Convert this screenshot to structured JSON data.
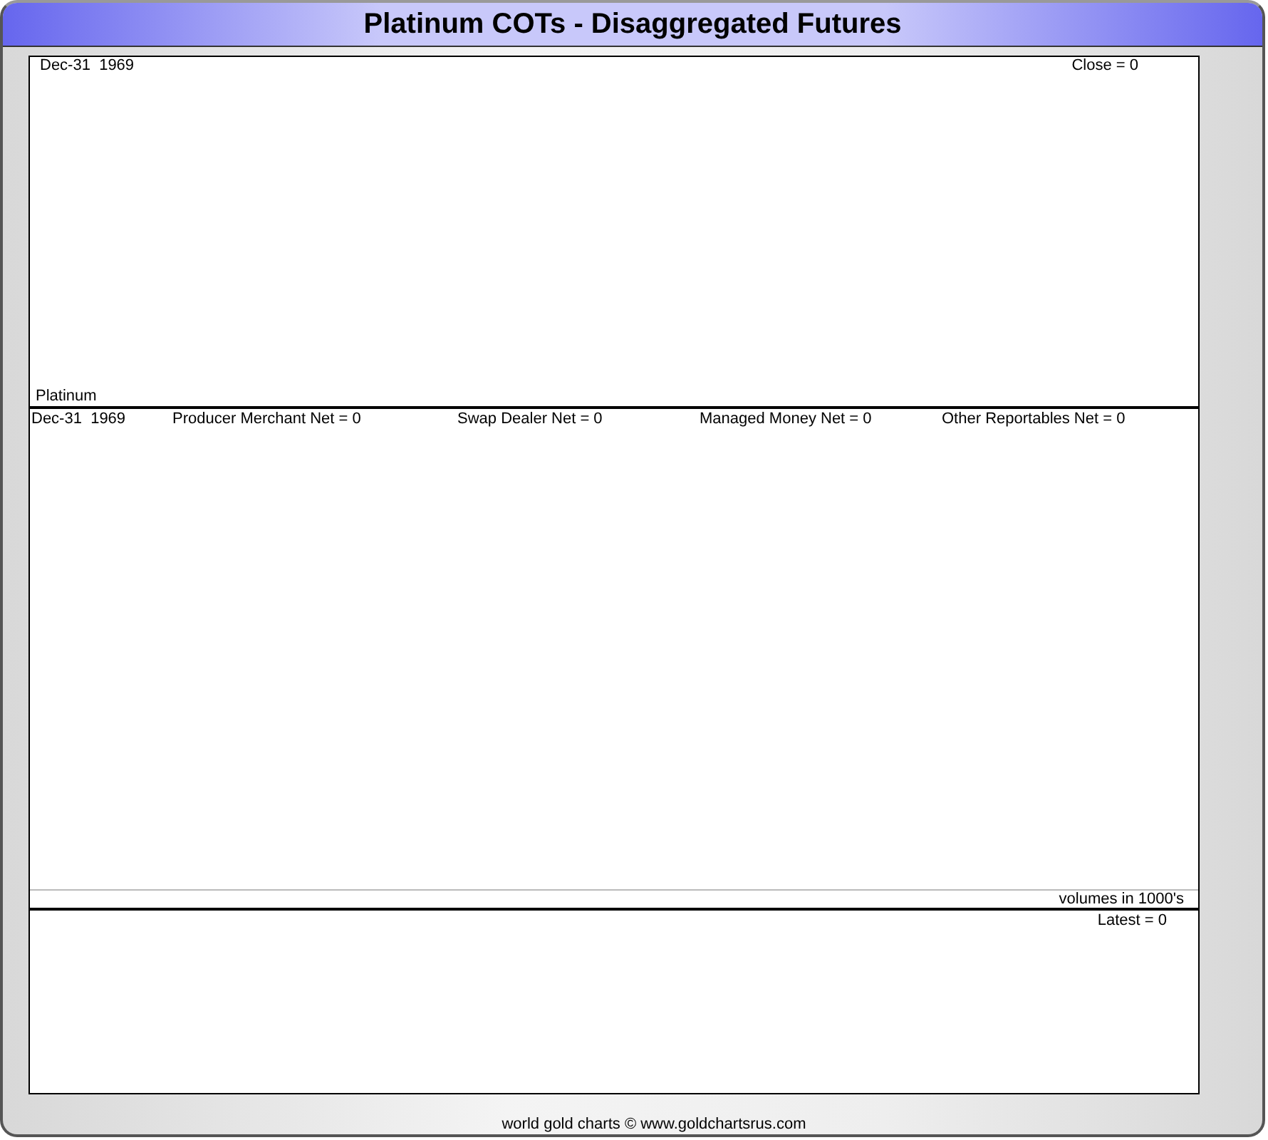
{
  "title": "Platinum COTs - Disaggregated Futures",
  "price_panel": {
    "date": "Dec-31  1969",
    "close": "Close = 0",
    "instrument": "Platinum"
  },
  "cot_panel": {
    "date": "Dec-31  1969",
    "legends": [
      {
        "label": "Producer Merchant Net = 0"
      },
      {
        "label": "Swap Dealer Net = 0"
      },
      {
        "label": "Managed Money Net = 0"
      },
      {
        "label": "Other Reportables Net = 0"
      }
    ]
  },
  "volume_panel": {
    "note": "volumes in 1000's",
    "latest": "Latest = 0"
  },
  "footer": "world gold charts © www.goldchartsrus.com"
}
